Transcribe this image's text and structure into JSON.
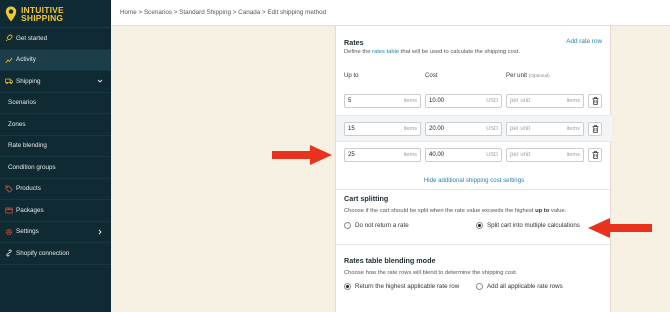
{
  "brand": {
    "line1": "INTUITIVE",
    "line2": "SHIPPING",
    "logo_icon": "location-pin-icon",
    "color": "#f3c730"
  },
  "sidebar": {
    "items": [
      {
        "label": "Get started",
        "icon": "rocket-icon"
      },
      {
        "label": "Activity",
        "icon": "chart-icon"
      },
      {
        "label": "Shipping",
        "icon": "truck-icon"
      },
      {
        "label": "Scenarios"
      },
      {
        "label": "Zones"
      },
      {
        "label": "Rate blending"
      },
      {
        "label": "Condition groups"
      },
      {
        "label": "Products",
        "icon": "tag-icon"
      },
      {
        "label": "Packages",
        "icon": "box-icon"
      },
      {
        "label": "Settings",
        "icon": "gear-icon"
      },
      {
        "label": "Shopify connection",
        "icon": "link-icon"
      }
    ]
  },
  "breadcrumb": "Home > Scenarios > Standard Shipping > Canada > Edit shipping method",
  "rates": {
    "title": "Rates",
    "desc_prefix": "Define the ",
    "desc_link": "rates table",
    "desc_suffix": " that will be used to calculate the shipping cost.",
    "add_rate": "Add rate row",
    "col_up_to": "Up to",
    "col_cost": "Cost",
    "col_per_unit": "Per unit",
    "col_optional": "(Optional)",
    "rows": [
      {
        "up_to": "5",
        "up_to_unit": "items",
        "cost": "10.00",
        "currency": "USD",
        "per_unit_placeholder": "per unit",
        "per_unit_unit": "items"
      },
      {
        "up_to": "15",
        "up_to_unit": "items",
        "cost": "20.00",
        "currency": "USD",
        "per_unit_placeholder": "per unit",
        "per_unit_unit": "items"
      },
      {
        "up_to": "25",
        "up_to_unit": "items",
        "cost": "40.00",
        "currency": "USD",
        "per_unit_placeholder": "per unit",
        "per_unit_unit": "items"
      }
    ],
    "hide_link": "Hide additional shipping cost settings"
  },
  "cart_splitting": {
    "title": "Cart splitting",
    "desc_prefix": "Choose if the cart should be split when the rate value exceeds the highest ",
    "desc_bold": "up to",
    "desc_suffix": " value.",
    "option_no": "Do not return a rate",
    "option_split": "Split cart into multiple calculations",
    "selected": "split"
  },
  "blending": {
    "title": "Rates table blending mode",
    "desc": "Choose how the rate rows will blend to determine the shipping cost.",
    "option_highest": "Return the highest applicable rate row",
    "option_all": "Add all applicable rate rows",
    "selected": "highest"
  },
  "annotation_color": "#e8321e"
}
